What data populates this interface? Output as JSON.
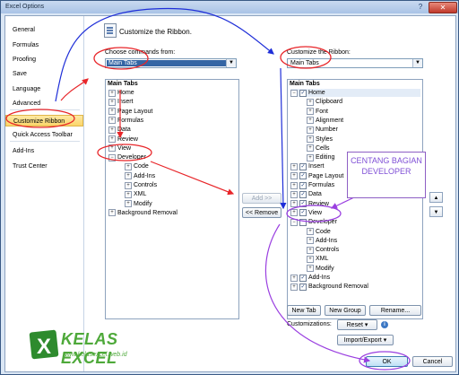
{
  "window": {
    "title": "Excel Options",
    "help_glyph": "?",
    "close_glyph": "✕"
  },
  "nav": {
    "items": [
      {
        "label": "General"
      },
      {
        "label": "Formulas"
      },
      {
        "label": "Proofing"
      },
      {
        "label": "Save"
      },
      {
        "label": "Language"
      },
      {
        "label": "Advanced"
      },
      {
        "label": "Customize Ribbon",
        "selected": true
      },
      {
        "label": "Quick Access Toolbar"
      },
      {
        "label": "Add-Ins"
      },
      {
        "label": "Trust Center"
      }
    ]
  },
  "header": {
    "title": "Customize the Ribbon."
  },
  "left_panel": {
    "choose_label": "Choose commands from:",
    "choose_value": "Main Tabs",
    "list_header": "Main Tabs",
    "items": [
      {
        "label": "Home",
        "level": 0,
        "exp": "+"
      },
      {
        "label": "Insert",
        "level": 0,
        "exp": "+"
      },
      {
        "label": "Page Layout",
        "level": 0,
        "exp": "+"
      },
      {
        "label": "Formulas",
        "level": 0,
        "exp": "+"
      },
      {
        "label": "Data",
        "level": 0,
        "exp": "+"
      },
      {
        "label": "Review",
        "level": 0,
        "exp": "+"
      },
      {
        "label": "View",
        "level": 0,
        "exp": "+"
      },
      {
        "label": "Developer",
        "level": 0,
        "exp": "−"
      },
      {
        "label": "Code",
        "level": 1,
        "exp": "+"
      },
      {
        "label": "Add-Ins",
        "level": 1,
        "exp": "+"
      },
      {
        "label": "Controls",
        "level": 1,
        "exp": "+"
      },
      {
        "label": "XML",
        "level": 1,
        "exp": "+"
      },
      {
        "label": "Modify",
        "level": 1,
        "exp": "+"
      },
      {
        "label": "Background Removal",
        "level": 0,
        "exp": "+"
      }
    ]
  },
  "middle": {
    "add_label": "Add >>",
    "remove_label": "<< Remove"
  },
  "right_panel": {
    "customize_label": "Customize the Ribbon:",
    "customize_value": "Main Tabs",
    "list_header": "Main Tabs",
    "items": [
      {
        "label": "Home",
        "level": 0,
        "exp": "−",
        "checked": true,
        "selected": true
      },
      {
        "label": "Clipboard",
        "level": 1,
        "exp": "+"
      },
      {
        "label": "Font",
        "level": 1,
        "exp": "+"
      },
      {
        "label": "Alignment",
        "level": 1,
        "exp": "+"
      },
      {
        "label": "Number",
        "level": 1,
        "exp": "+"
      },
      {
        "label": "Styles",
        "level": 1,
        "exp": "+"
      },
      {
        "label": "Cells",
        "level": 1,
        "exp": "+"
      },
      {
        "label": "Editing",
        "level": 1,
        "exp": "+"
      },
      {
        "label": "Insert",
        "level": 0,
        "exp": "+",
        "checked": true
      },
      {
        "label": "Page Layout",
        "level": 0,
        "exp": "+",
        "checked": true
      },
      {
        "label": "Formulas",
        "level": 0,
        "exp": "+",
        "checked": true
      },
      {
        "label": "Data",
        "level": 0,
        "exp": "+",
        "checked": true
      },
      {
        "label": "Review",
        "level": 0,
        "exp": "+",
        "checked": true
      },
      {
        "label": "View",
        "level": 0,
        "exp": "+",
        "checked": true
      },
      {
        "label": "Developer",
        "level": 0,
        "exp": "−",
        "checked": false
      },
      {
        "label": "Code",
        "level": 1,
        "exp": "+"
      },
      {
        "label": "Add-Ins",
        "level": 1,
        "exp": "+"
      },
      {
        "label": "Controls",
        "level": 1,
        "exp": "+"
      },
      {
        "label": "XML",
        "level": 1,
        "exp": "+"
      },
      {
        "label": "Modify",
        "level": 1,
        "exp": "+"
      },
      {
        "label": "Add-Ins",
        "level": 0,
        "exp": "+",
        "checked": true
      },
      {
        "label": "Background Removal",
        "level": 0,
        "exp": "+",
        "checked": true
      }
    ],
    "move_up_glyph": "▲",
    "move_down_glyph": "▼"
  },
  "right_buttons": {
    "new_tab": "New Tab",
    "new_group": "New Group",
    "rename": "Rename...",
    "customizations_label": "Customizations:",
    "reset": "Reset ▾",
    "import_export": "Import/Export ▾",
    "info_glyph": "i"
  },
  "footer": {
    "ok": "OK",
    "cancel": "Cancel"
  },
  "annotation": {
    "callout_text": "CENTANG BAGIAN DEVELOPER"
  },
  "watermark": {
    "brand": "KELAS EXCEL",
    "url": "www.kelasexcel.web.id",
    "logo_letter": "X"
  },
  "colors": {
    "selected_nav": "#fbd56a",
    "combo_highlight": "#3465a4",
    "red_annotation": "#e8262a",
    "blue_annotation": "#1f2fd8",
    "purple_annotation": "#9a3fe0",
    "logo_green": "#4ea93a"
  }
}
